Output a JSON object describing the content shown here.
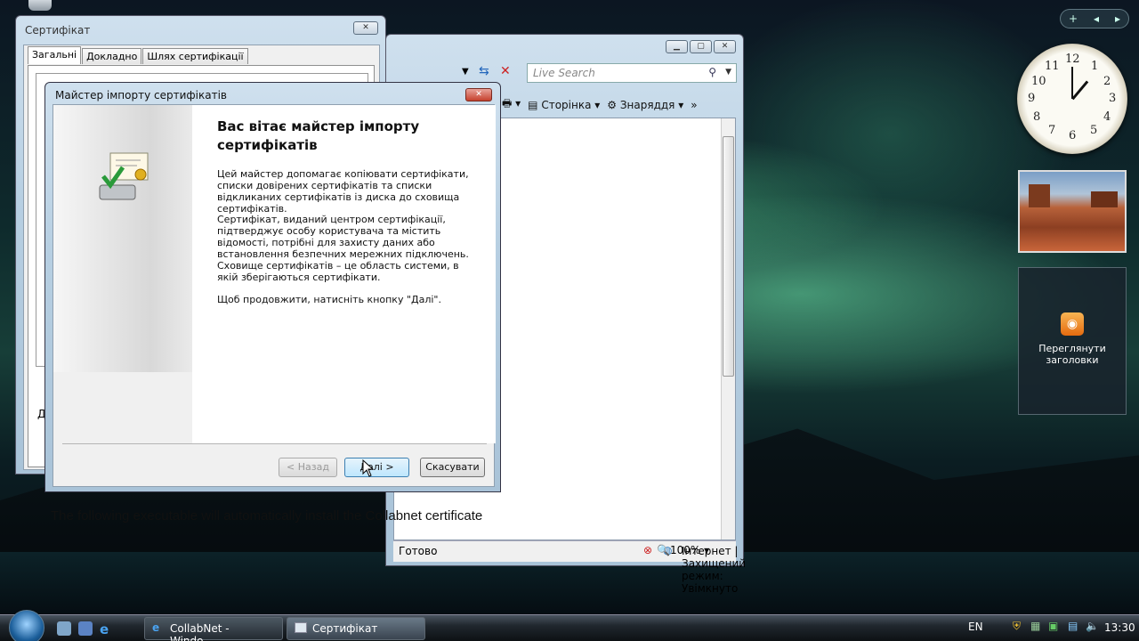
{
  "ie_window": {
    "search_placeholder": "Live Search",
    "toolbar": {
      "page_label": "Сторінка",
      "tools_label": "Знаряддя"
    },
    "content_text": "The following executable will automatically install the Collabnet certificate",
    "status": {
      "ready": "Готово",
      "zone": "Інтернет | Захищений режим: Увімкнуто",
      "zoom": "100%"
    }
  },
  "cert_window": {
    "title": "Сертифікат",
    "tabs": [
      "Загальні",
      "Докладно",
      "Шлях сертифікації"
    ],
    "partial_label": "Д"
  },
  "wizard": {
    "title": "Майстер імпорту сертифікатів",
    "heading": "Вас вітає майстер імпорту сертифікатів",
    "para1": "Цей майстер допомагає копіювати сертифікати, списки довірених сертифікатів та списки відкликаних сертифікатів із диска до сховища сертифікатів.",
    "para2": "Сертифікат, виданий центром сертифікації, підтверджує особу користувача та містить відомості, потрібні для захисту даних або встановлення безпечних мережних підключень. Сховище сертифікатів – це область системи, в якій зберігаються сертифікати.",
    "para3": "Щоб продовжити, натисніть кнопку \"Далі\".",
    "buttons": {
      "back": "< Назад",
      "next": "Далі >",
      "cancel": "Скасувати"
    }
  },
  "sidebar": {
    "clock_numbers": [
      "12",
      "1",
      "2",
      "3",
      "4",
      "5",
      "6",
      "7",
      "8",
      "9",
      "10",
      "11"
    ],
    "feed_label": "Переглянути заголовки"
  },
  "taskbar": {
    "tasks": [
      "CollabNet - Windo...",
      "Сертифікат"
    ],
    "language": "EN",
    "time": "13:30"
  }
}
